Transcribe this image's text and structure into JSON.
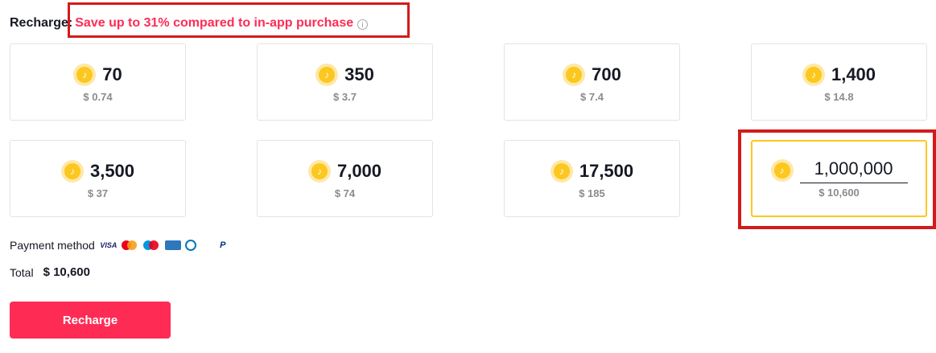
{
  "header": {
    "label": "Recharge",
    "colon": ":",
    "promo_text": "Save up to 31% compared to in-app purchase"
  },
  "packages": [
    {
      "coins": "70",
      "price": "$ 0.74"
    },
    {
      "coins": "350",
      "price": "$ 3.7"
    },
    {
      "coins": "700",
      "price": "$ 7.4"
    },
    {
      "coins": "1,400",
      "price": "$ 14.8"
    },
    {
      "coins": "3,500",
      "price": "$ 37"
    },
    {
      "coins": "7,000",
      "price": "$ 74"
    },
    {
      "coins": "17,500",
      "price": "$ 185"
    }
  ],
  "custom_package": {
    "value": "1,000,000",
    "price": "$ 10,600",
    "selected": true
  },
  "payment": {
    "label": "Payment method",
    "methods": [
      "visa-icon",
      "mastercard-icon",
      "maestro-icon",
      "amex-icon",
      "diners-icon",
      "jcb-icon",
      "paypal-icon"
    ],
    "visa_text": "VISA",
    "paypal_text": "P"
  },
  "total": {
    "label": "Total",
    "value": "$ 10,600"
  },
  "button": {
    "label": "Recharge"
  },
  "colors": {
    "accent": "#fe2c55",
    "coin": "#fcc71f",
    "annotation": "#d31b1b"
  }
}
